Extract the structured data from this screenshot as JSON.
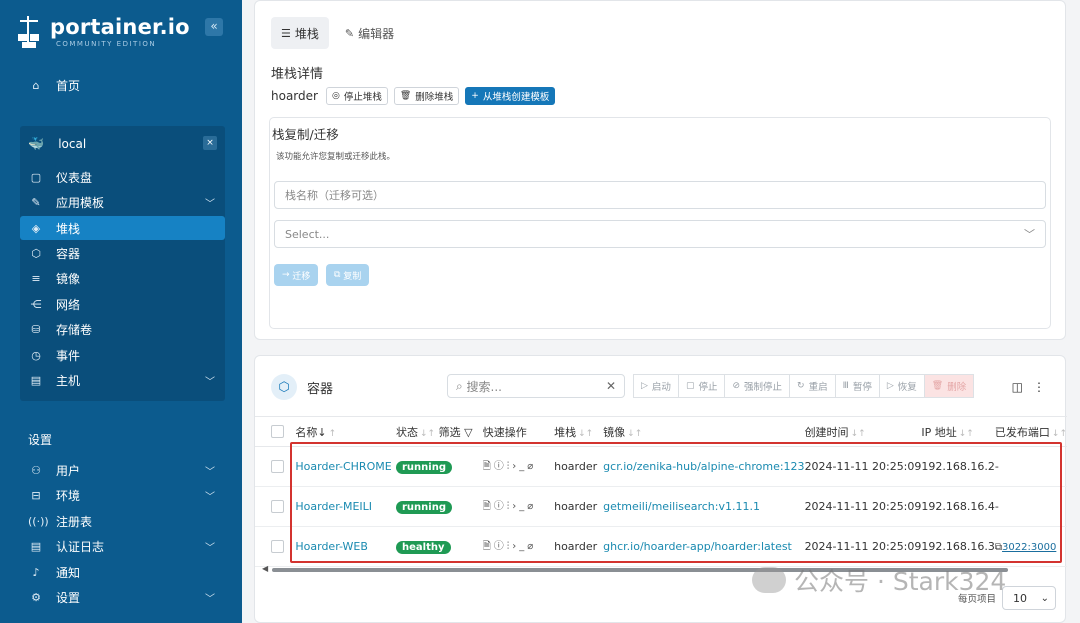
{
  "sidebar": {
    "logo_title": "portainer.io",
    "logo_sub": "COMMUNITY EDITION",
    "collapse_icon": "«",
    "home": "首页",
    "env_name": "local",
    "env_close": "×",
    "env_items": [
      {
        "label": "仪表盘",
        "icon": "▢",
        "chev": false
      },
      {
        "label": "应用模板",
        "icon": "✎",
        "chev": true
      },
      {
        "label": "堆栈",
        "icon": "◈",
        "chev": false,
        "active": true
      },
      {
        "label": "容器",
        "icon": "⬡",
        "chev": false
      },
      {
        "label": "镜像",
        "icon": "≡",
        "chev": false
      },
      {
        "label": "网络",
        "icon": "⋲",
        "chev": false
      },
      {
        "label": "存储卷",
        "icon": "⛁",
        "chev": false
      },
      {
        "label": "事件",
        "icon": "◷",
        "chev": false
      },
      {
        "label": "主机",
        "icon": "▤",
        "chev": true
      }
    ],
    "settings_title": "设置",
    "settings_items": [
      {
        "label": "用户",
        "icon": "⚇",
        "chev": true
      },
      {
        "label": "环境",
        "icon": "⊟",
        "chev": true
      },
      {
        "label": "注册表",
        "icon": "((·))",
        "chev": false
      },
      {
        "label": "认证日志",
        "icon": "▤",
        "chev": true
      },
      {
        "label": "通知",
        "icon": "♪",
        "chev": false
      },
      {
        "label": "设置",
        "icon": "⚙",
        "chev": true
      }
    ]
  },
  "stack": {
    "tabs": [
      {
        "label": "堆栈",
        "icon": "☰",
        "active": true
      },
      {
        "label": "编辑器",
        "icon": "✎",
        "active": false
      }
    ],
    "details_title": "堆栈详情",
    "name": "hoarder",
    "buttons": {
      "stop": "停止堆栈",
      "delete": "删除堆栈",
      "template": "从堆栈创建模板"
    },
    "migrate": {
      "title": "栈复制/迁移",
      "desc": "该功能允许您复制或迁移此栈。",
      "name_placeholder": "栈名称（迁移可选）",
      "select_placeholder": "Select...",
      "migrate_btn": "迁移",
      "copy_btn": "复制"
    }
  },
  "containers": {
    "title": "容器",
    "search_placeholder": "搜索...",
    "actions": [
      "启动",
      "停止",
      "强制停止",
      "重启",
      "暂停",
      "恢复",
      "删除"
    ],
    "columns": {
      "name": "名称",
      "state": "状态",
      "filter": "筛选",
      "quick": "快速操作",
      "stack": "堆栈",
      "image": "镜像",
      "created": "创建时间",
      "ip": "IP 地址",
      "ports": "已发布端口"
    },
    "rows": [
      {
        "name": "Hoarder-CHROME",
        "state": "running",
        "stack": "hoarder",
        "image": "gcr.io/zenika-hub/alpine-chrome:123",
        "created": "2024-11-11 20:25:09",
        "ip": "192.168.16.2",
        "port": "-"
      },
      {
        "name": "Hoarder-MEILI",
        "state": "running",
        "stack": "hoarder",
        "image": "getmeili/meilisearch:v1.11.1",
        "created": "2024-11-11 20:25:09",
        "ip": "192.168.16.4",
        "port": "-"
      },
      {
        "name": "Hoarder-WEB",
        "state": "healthy",
        "stack": "hoarder",
        "image": "ghcr.io/hoarder-app/hoarder:latest",
        "created": "2024-11-11 20:25:09",
        "ip": "192.168.16.3",
        "port": "3022:3000"
      }
    ],
    "quick_icons": "🗎ⓘ⫶›_⌀",
    "per_page_label": "每页项目",
    "per_page_value": "10"
  },
  "watermark": "公众号 · Stark324"
}
